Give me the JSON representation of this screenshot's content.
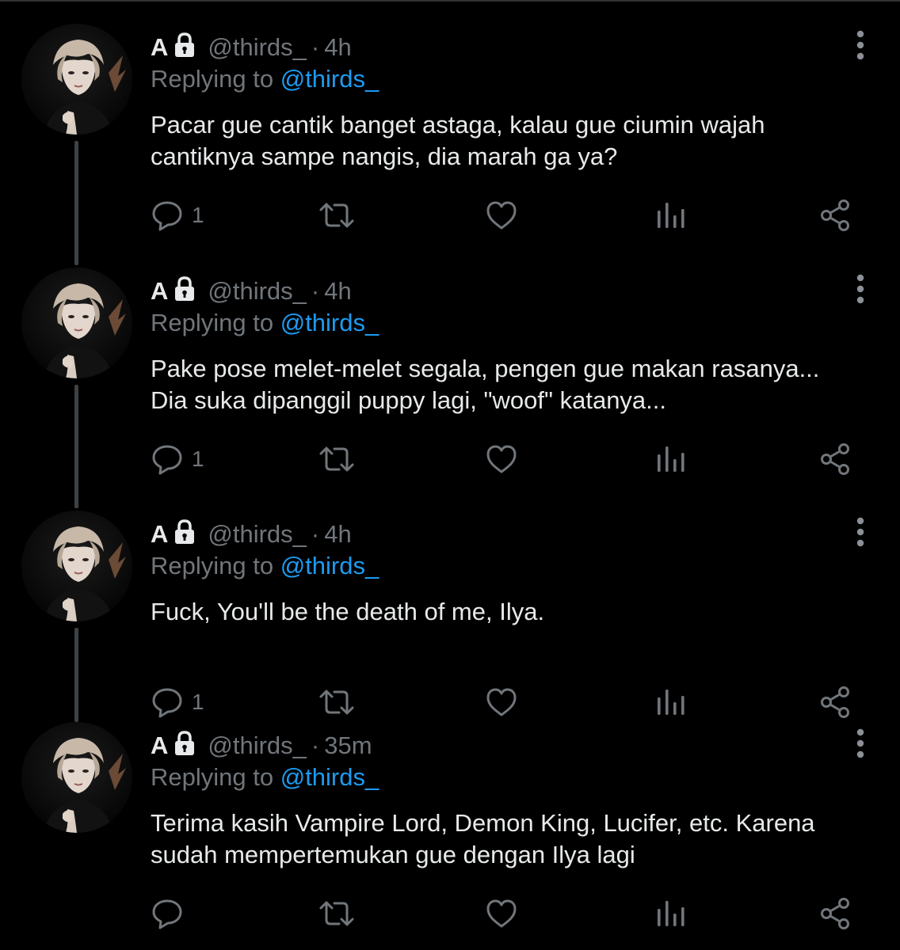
{
  "tweets": [
    {
      "display_name": "A",
      "handle": "@thirds_",
      "separator": "·",
      "time": "4h",
      "replying_prefix": "Replying to",
      "replying_to": "@thirds_",
      "text_lines": [
        "Pacar gue cantik banget astaga, kalau gue ciumin wajah",
        "cantiknya sampe nangis, dia marah ga ya?"
      ],
      "reply_count": "1"
    },
    {
      "display_name": "A",
      "handle": "@thirds_",
      "separator": "·",
      "time": "4h",
      "replying_prefix": "Replying to",
      "replying_to": "@thirds_",
      "text_lines": [
        "Pake pose melet-melet segala, pengen gue makan rasanya...",
        "Dia suka dipanggil puppy lagi, \"woof\" katanya..."
      ],
      "reply_count": "1"
    },
    {
      "display_name": "A",
      "handle": "@thirds_",
      "separator": "·",
      "time": "4h",
      "replying_prefix": "Replying to",
      "replying_to": "@thirds_",
      "text_lines": [
        "Fuck, You'll be the death of me, Ilya."
      ],
      "reply_count": "1"
    },
    {
      "display_name": "A",
      "handle": "@thirds_",
      "separator": "·",
      "time": "35m",
      "replying_prefix": "Replying to",
      "replying_to": "@thirds_",
      "text_lines": [
        "Terima kasih Vampire Lord, Demon King, Lucifer, etc. Karena",
        "sudah mempertemukan gue dengan Ilya lagi"
      ],
      "reply_count": ""
    }
  ],
  "icons": {
    "lock": "lock-icon",
    "more": "more-vertical-icon",
    "reply": "reply-bubble-icon",
    "retweet": "retweet-icon",
    "like": "heart-icon",
    "views": "analytics-bars-icon",
    "share": "share-icon"
  },
  "colors": {
    "background": "#000000",
    "primary_text": "#e7e9ea",
    "secondary_text": "#71767b",
    "accent_mention": "#1d9bf0",
    "thread_line": "#3e4144"
  }
}
